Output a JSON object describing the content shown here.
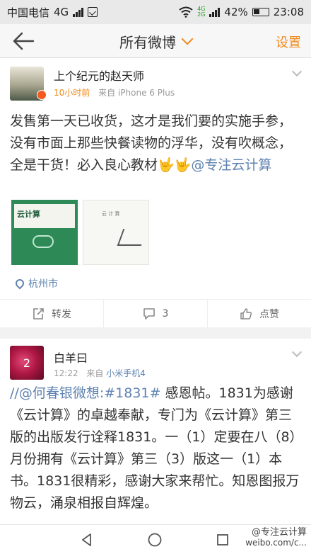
{
  "status_bar": {
    "carrier": "中国电信",
    "network": "4G",
    "net_small_top": "4G",
    "net_small_bottom": "2G",
    "battery": "42%",
    "time": "23:08"
  },
  "title_bar": {
    "title": "所有微博",
    "settings": "设置"
  },
  "posts": [
    {
      "username": "上个纪元的赵天师",
      "time": "10小时前",
      "source_prefix": "来自",
      "source": "iPhone 6 Plus",
      "text": "发售第一天已收货，这才是我们要的实施手参，没有市面上那些快餐读物的浮华，没有吹概念，全是干货！必入良心教材🤟🤟",
      "mention": "@专注云计算",
      "images": [
        {
          "cover_title": "云计算"
        },
        {
          "cover_title": "云 计 算"
        }
      ],
      "location": "杭州市",
      "actions": {
        "repost": "转发",
        "comment": "3",
        "like": "点赞"
      }
    },
    {
      "username": "白羊曰",
      "avatar_text": "2",
      "time": "12:22",
      "source_prefix": "来自",
      "source": "小米手机4",
      "prefix": "//",
      "mention": "@何春银微想",
      "topic": ":#1831#",
      "text": " 感恩帖。1831为感谢《云计算》的卓越奉献，专门为《云计算》第三版的出版发行诠释1831。一（1）定要在八（8）月份拥有《云计算》第三（3）版这一（1）本书。1831很精彩，感谢大家来帮忙。知恩图报万物云，涌泉相报自辉煌。"
    }
  ],
  "watermark": {
    "line1": "@专注云计算",
    "line2": "weibo.com/c..."
  }
}
